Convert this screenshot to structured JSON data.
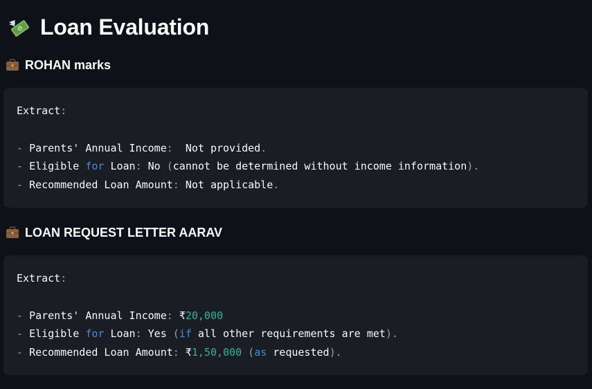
{
  "page": {
    "title": "Loan Evaluation",
    "title_icon": "money-with-wings-icon",
    "section_icon": "briefcase-icon"
  },
  "sections": [
    {
      "heading": "ROHAN marks",
      "code": {
        "header": "Extract",
        "income_label": "Parents' Annual Income",
        "income_value": "Not provided",
        "eligible_pre": "Eligible",
        "eligible_kw": "for",
        "eligible_post": "Loan",
        "eligible_value": "No",
        "eligible_note": "cannot be determined without income information",
        "amount_label": "Recommended Loan Amount",
        "amount_value": "Not applicable"
      }
    },
    {
      "heading": "LOAN REQUEST LETTER AARAV",
      "code": {
        "header": "Extract",
        "income_label": "Parents' Annual Income",
        "income_currency": "₹",
        "income_number": "20,000",
        "eligible_pre": "Eligible",
        "eligible_kw": "for",
        "eligible_post": "Loan",
        "eligible_value": "Yes",
        "eligible_kw2": "if",
        "eligible_note": "all other requirements are met",
        "amount_label": "Recommended Loan Amount",
        "amount_currency": "₹",
        "amount_number": "1,50,000",
        "amount_kw": "as",
        "amount_note": "requested"
      }
    }
  ],
  "colors": {
    "background": "#0e1117",
    "code_background": "#1a1d24",
    "text": "#fafafa",
    "dash": "#f0894d",
    "keyword": "#3b8ed8",
    "number": "#2db3a0",
    "punctuation": "#9aa0a6"
  }
}
